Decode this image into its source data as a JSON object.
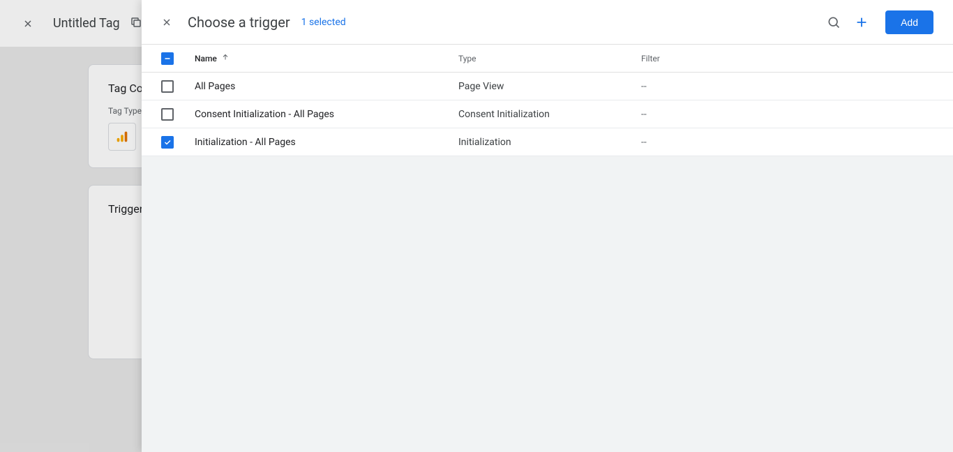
{
  "bg": {
    "title": "Untitled Tag",
    "card1_title": "Tag Configuration",
    "tag_type_label": "Tag Type",
    "card2_title": "Triggering"
  },
  "overlay": {
    "title": "Choose a trigger",
    "selected": "1 selected",
    "add_label": "Add"
  },
  "columns": {
    "name": "Name",
    "type": "Type",
    "filter": "Filter"
  },
  "rows": [
    {
      "checked": false,
      "name": "All Pages",
      "type": "Page View",
      "filter": "--"
    },
    {
      "checked": false,
      "name": "Consent Initialization - All Pages",
      "type": "Consent Initialization",
      "filter": "--"
    },
    {
      "checked": true,
      "name": "Initialization - All Pages",
      "type": "Initialization",
      "filter": "--"
    }
  ]
}
